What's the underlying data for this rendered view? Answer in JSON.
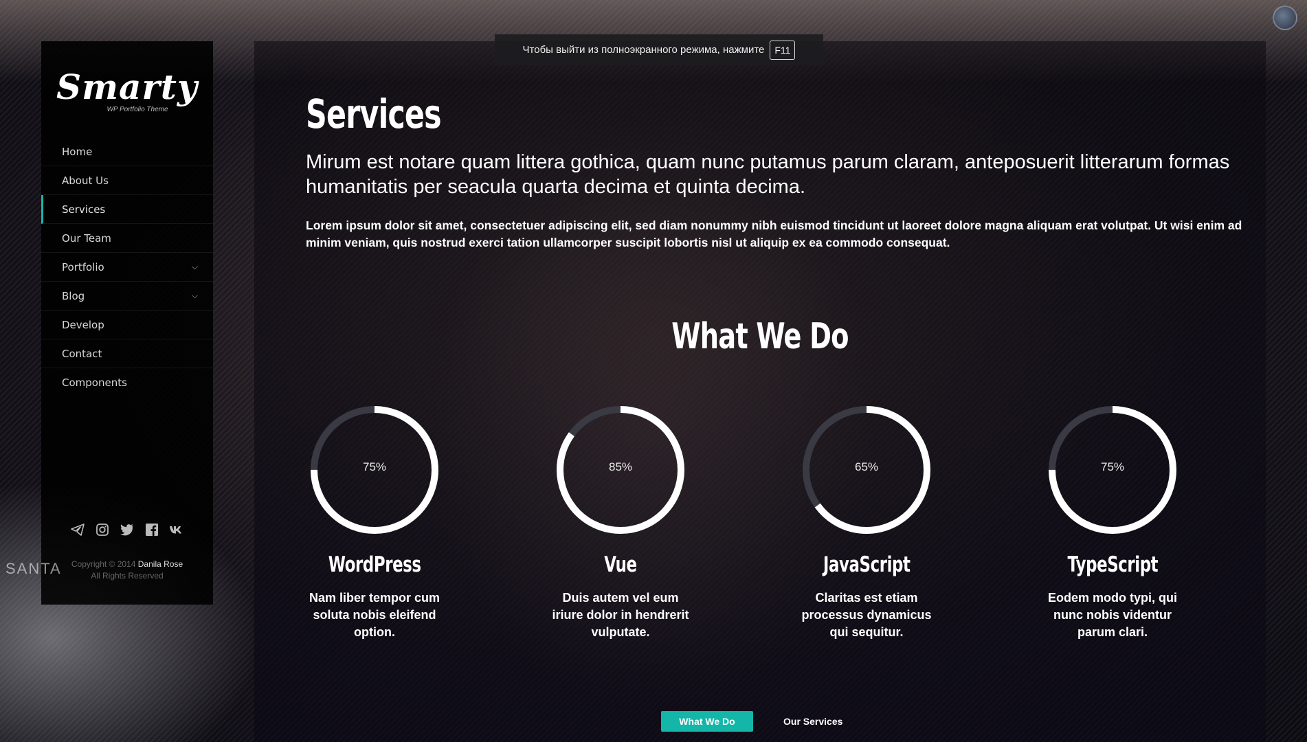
{
  "sidebar": {
    "logo": {
      "word": "Smarty",
      "subtitle": "WP Portfolio Theme"
    },
    "nav": [
      {
        "label": "Home",
        "active": false,
        "has_submenu": false
      },
      {
        "label": "About Us",
        "active": false,
        "has_submenu": false
      },
      {
        "label": "Services",
        "active": true,
        "has_submenu": false
      },
      {
        "label": "Our Team",
        "active": false,
        "has_submenu": false
      },
      {
        "label": "Portfolio",
        "active": false,
        "has_submenu": true
      },
      {
        "label": "Blog",
        "active": false,
        "has_submenu": true
      },
      {
        "label": "Develop",
        "active": false,
        "has_submenu": false
      },
      {
        "label": "Contact",
        "active": false,
        "has_submenu": false
      },
      {
        "label": "Components",
        "active": false,
        "has_submenu": false
      }
    ],
    "social_icons": [
      "telegram-icon",
      "instagram-icon",
      "twitter-icon",
      "facebook-icon",
      "vk-icon"
    ],
    "copyright": {
      "prefix": "Copyright © 2014",
      "author": "Danila Rose",
      "rights": "All Rights Reserved"
    },
    "watermark": "SANTA"
  },
  "fullscreen_notice": {
    "text": "Чтобы выйти из полноэкранного режима, нажмите",
    "key": "F11"
  },
  "main": {
    "title": "Services",
    "lead": "Mirum est notare quam littera gothica, quam nunc putamus parum claram, anteposuerit litterarum formas humanitatis per seacula quarta decima et quinta decima.",
    "body": "Lorem ipsum dolor sit amet, consectetuer adipiscing elit, sed diam nonummy nibh euismod tincidunt ut laoreet dolore magna aliquam erat volutpat. Ut wisi enim ad minim veniam, quis nostrud exerci tation ullamcorper suscipit lobortis nisl ut aliquip ex ea commodo consequat.",
    "section_title": "What We Do",
    "skills": [
      {
        "name": "WordPress",
        "percent_label": "75%",
        "value": 0.75,
        "description": "Nam liber tempor cum soluta nobis eleifend option."
      },
      {
        "name": "Vue",
        "percent_label": "85%",
        "value": 0.85,
        "description": "Duis autem vel eum iriure dolor in hendrerit vulputate."
      },
      {
        "name": "JavaScript",
        "percent_label": "65%",
        "value": 0.65,
        "description": "Claritas est etiam processus dynamicus qui sequitur."
      },
      {
        "name": "TypeScript",
        "percent_label": "75%",
        "value": 0.75,
        "description": "Eodem modo typi, qui nunc nobis videntur parum clari."
      }
    ],
    "tabs": [
      {
        "label": "What We Do",
        "active": true
      },
      {
        "label": "Our Services",
        "active": false
      }
    ]
  },
  "colors": {
    "accent": "#13b6a8",
    "ring_track": "#3a3a44",
    "ring_fill": "#ffffff"
  }
}
